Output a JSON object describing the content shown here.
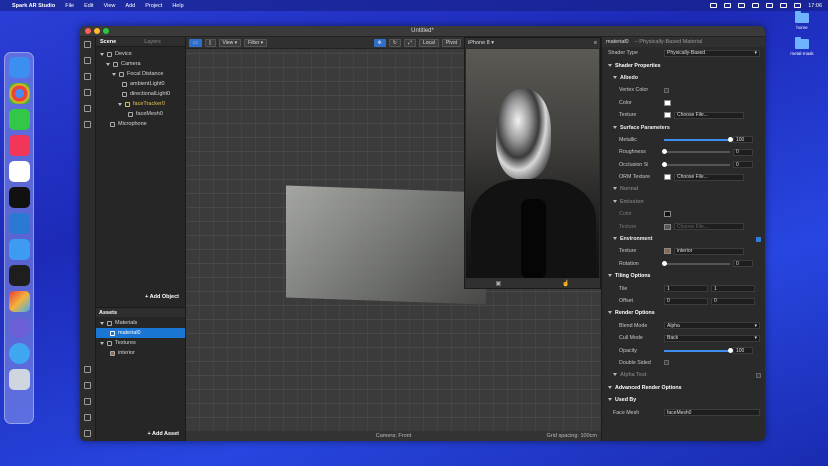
{
  "menubar": {
    "app_name": "Spark AR Studio",
    "items": [
      "File",
      "Edit",
      "View",
      "Add",
      "Project",
      "Help"
    ],
    "clock": "17:06"
  },
  "desktop": {
    "icons": [
      "home",
      "metal-mask"
    ]
  },
  "dock": {
    "apps": [
      "Finder",
      "Chrome",
      "Messages",
      "Music",
      "Slack",
      "Terminal",
      "VS Code",
      "Mail",
      "Figma",
      "Spark AR",
      "Marble",
      "Tweetbot",
      "Trash"
    ]
  },
  "window": {
    "title": "Untitled*"
  },
  "scene_panel": {
    "tabs": [
      "Scene",
      "Layers"
    ],
    "tree": [
      {
        "label": "Device",
        "depth": 0
      },
      {
        "label": "Camera",
        "depth": 1
      },
      {
        "label": "Focal Distance",
        "depth": 2
      },
      {
        "label": "ambientLight0",
        "depth": 3
      },
      {
        "label": "directionalLight0",
        "depth": 3
      },
      {
        "label": "faceTracker0",
        "depth": 3
      },
      {
        "label": "faceMesh0",
        "depth": 4
      },
      {
        "label": "Microphone",
        "depth": 1
      }
    ],
    "add_object": "+ Add Object",
    "assets_title": "Assets",
    "assets": [
      {
        "label": "Materials",
        "depth": 0
      },
      {
        "label": "material0",
        "depth": 1
      },
      {
        "label": "Textures",
        "depth": 0
      },
      {
        "label": "interior",
        "depth": 1
      }
    ],
    "add_asset": "+ Add Asset"
  },
  "viewport": {
    "view_btn": "View",
    "filter_btn": "Filter",
    "local_btn": "Local",
    "pivot_btn": "Pivot",
    "status": "Camera: Front",
    "grid_spacing": "Grid spacing: 100cm"
  },
  "simulator": {
    "device": "iPhone 8"
  },
  "properties": {
    "material_name": "material0",
    "material_type": "– Physically-Based Material",
    "shader_type_label": "Shader Type",
    "shader_type_value": "Physically-Based",
    "shader_properties": "Shader Properties",
    "albedo": "Albedo",
    "vertex_color": "Vertex Color",
    "color": "Color",
    "texture": "Texture",
    "choose_file": "Choose File...",
    "surface_parameters": "Surface Parameters",
    "metallic": "Metallic",
    "metallic_value": "100",
    "roughness": "Roughness",
    "roughness_value": "0",
    "occlusion_strength": "Occlusion Strength",
    "occlusion_value": "0",
    "orm_texture": "ORM Texture",
    "normal": "Normal",
    "emission": "Emission",
    "environment": "Environment",
    "env_texture_value": "interior",
    "rotation": "Rotation",
    "rotation_value": "0",
    "tiling_options": "Tiling Options",
    "tile": "Tile",
    "tile_x": "1",
    "tile_y": "1",
    "offset": "Offset",
    "offset_x": "0",
    "offset_y": "0",
    "render_options": "Render Options",
    "blend_mode": "Blend Mode",
    "blend_mode_value": "Alpha",
    "cull_mode": "Cull Mode",
    "cull_mode_value": "Back",
    "opacity": "Opacity",
    "opacity_value": "100",
    "double_sided": "Double Sided",
    "alpha_test": "Alpha Test",
    "advanced_render": "Advanced Render Options",
    "used_by": "Used By",
    "face_mesh_label": "Face Mesh",
    "face_mesh_value": "faceMesh0",
    "metallic_level": 1.0,
    "opacity_level": 1.0
  },
  "colors": {
    "accent": "#1a76d2",
    "tracker": "#e8c24a"
  }
}
